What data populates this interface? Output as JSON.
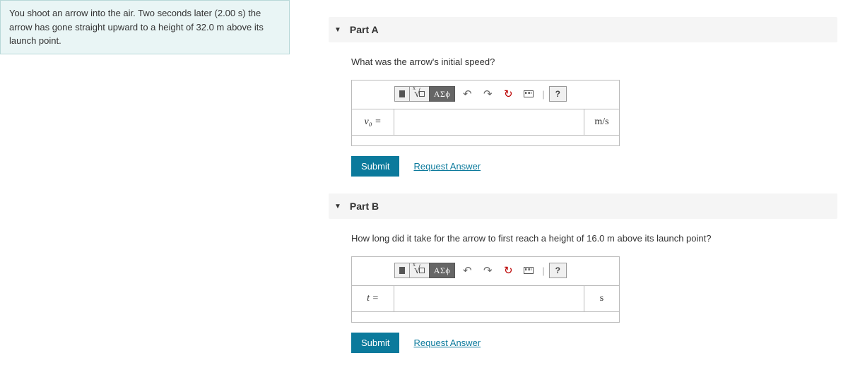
{
  "problem": "You shoot an arrow into the air. Two seconds later (2.00 s) the arrow has gone straight upward to a height of 32.0 m above its launch point.",
  "partA": {
    "title": "Part A",
    "question": "What was the arrow's initial speed?",
    "variable": "v₀ =",
    "units": "m/s",
    "toolbar": {
      "greek": "ΑΣϕ",
      "help": "?"
    },
    "submit": "Submit",
    "request": "Request Answer"
  },
  "partB": {
    "title": "Part B",
    "question": "How long did it take for the arrow to first reach a height of 16.0 m above its launch point?",
    "variable": "t =",
    "units": "s",
    "toolbar": {
      "greek": "ΑΣϕ",
      "help": "?"
    },
    "submit": "Submit",
    "request": "Request Answer"
  }
}
